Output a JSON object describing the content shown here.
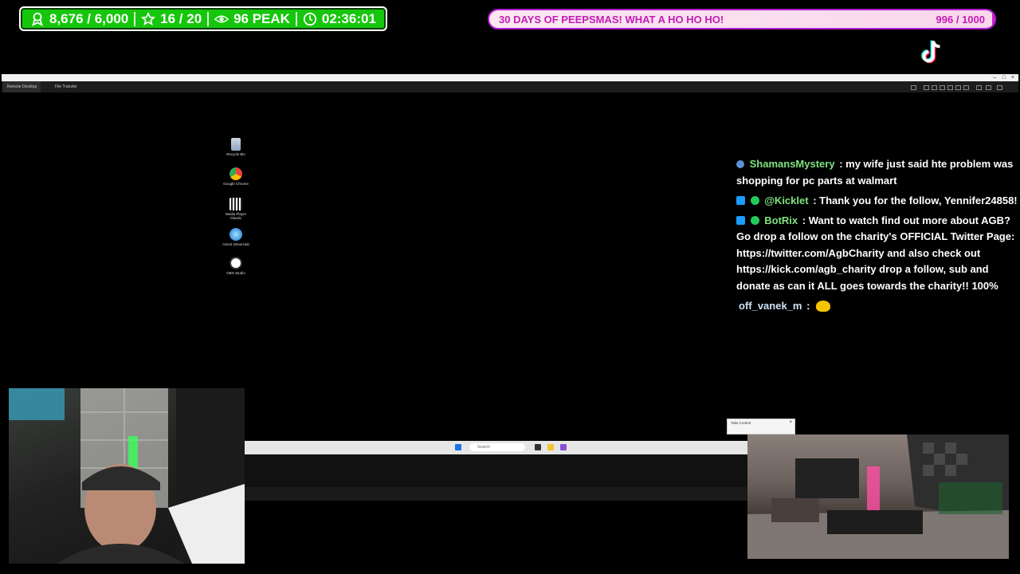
{
  "stats": {
    "followers": "8,676 / 6,000",
    "subs": "16 / 20",
    "viewers": "96 PEAK",
    "uptime": "02:36:01",
    "colors": {
      "bar": "#16c60c"
    }
  },
  "goal": {
    "title": "30 DAYS OF PEEPSMAS! WHAT A HO HO HO!",
    "count": "996 / 1000",
    "progress": 0.996,
    "colors": {
      "fill": "#fde8f0",
      "border": "#d61bd8",
      "text": "#c31bb8"
    }
  },
  "remote_desktop": {
    "tabs": [
      "Remote Desktop",
      "File Transfer"
    ],
    "desktop_icons": [
      {
        "label": "Recycle Bin",
        "icon": "recycle-bin-icon"
      },
      {
        "label": "Google Chrome",
        "icon": "chrome-icon"
      },
      {
        "label": "Media Player Classic",
        "icon": "media-player-icon"
      },
      {
        "label": "ASUS DriverHub",
        "icon": "asus-driverhub-icon"
      },
      {
        "label": "OBS Studio",
        "icon": "obs-icon"
      }
    ],
    "taskbar": {
      "search_placeholder": "Search"
    },
    "toast": {
      "title": "Take Control"
    }
  },
  "chat": [
    {
      "user": "ShamansMystery",
      "user_color": "#7fe37f",
      "text": ": my wife just said hte problem was shopping for pc parts at walmart",
      "badges": [
        "sub"
      ]
    },
    {
      "user": "@Kicklet",
      "user_color": "#7fe37f",
      "text": ": Thank you for the follow, Yennifer24858!",
      "badges": [
        "mod",
        "verified"
      ]
    },
    {
      "user": "BotRix",
      "user_color": "#7fe37f",
      "text": ": Want to watch find out more about AGB? Go drop a follow on the charity's OFFICIAL Twitter Page: https://twitter.com/AgbCharity and also check out https://kick.com/agb_charity drop a follow, sub and donate as can it ALL goes towards the charity!! 100%",
      "badges": [
        "mod",
        "verified"
      ]
    },
    {
      "user": "off_vanek_m",
      "user_color": "#cfe3f5",
      "text": ":",
      "badges": [],
      "emote": "emote-icon"
    }
  ]
}
